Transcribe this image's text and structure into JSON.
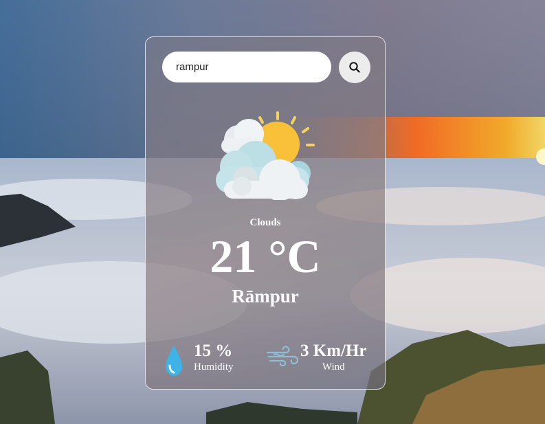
{
  "search": {
    "value": "rampur",
    "button_icon": "search-icon"
  },
  "weather": {
    "icon": "partly-cloudy-icon",
    "condition": "Clouds",
    "temperature": "21 °C",
    "city": "Rāmpur"
  },
  "humidity": {
    "icon": "water-drop-icon",
    "value": "15 %",
    "label": "Humidity"
  },
  "wind": {
    "icon": "wind-icon",
    "value": "3 Km/Hr",
    "label": "Wind"
  },
  "colors": {
    "card_border": "#ffffff",
    "search_button_bg": "#ececec",
    "drop_color": "#3fb2e6",
    "sun_color": "#f9c13a",
    "sunset_orange": "#ff7a1a"
  }
}
